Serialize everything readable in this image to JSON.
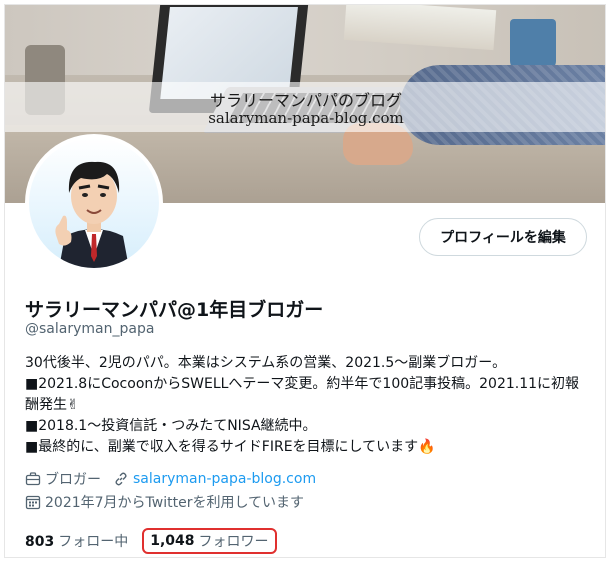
{
  "banner": {
    "title_jp": "サラリーマンパパのブログ",
    "title_url": "salaryman-papa-blog.com"
  },
  "profile": {
    "edit_button": "プロフィールを編集",
    "display_name": "サラリーマンパパ@1年目ブロガー",
    "handle": "@salaryman_papa",
    "bio_lines": [
      "30代後半、2児のパパ。本業はシステム系の営業、2021.5〜副業ブロガー。",
      "■2021.8にCocoonからSWELLへテーマ変更。約半年で100記事投稿。2021.11に初報",
      "酬発生✌",
      "■2018.1〜投資信託・つみたてNISA継続中。",
      "■最終的に、副業で収入を得るサイドFIREを目標にしています🔥"
    ],
    "category_icon": "briefcase-icon",
    "category": "ブロガー",
    "link_icon": "link-icon",
    "website": "salaryman-papa-blog.com",
    "calendar_icon": "calendar-icon",
    "joined": "2021年7月からTwitterを利用しています",
    "following_count": "803",
    "following_label": "フォロー中",
    "followers_count": "1,048",
    "followers_label": "フォロワー"
  },
  "colors": {
    "link": "#1d9bf0",
    "highlight": "#e0302f",
    "secondary_text": "#536471"
  }
}
